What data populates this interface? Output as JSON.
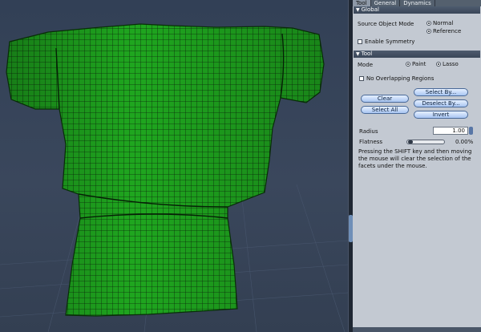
{
  "tabs": [
    {
      "label": "Tool",
      "active": true
    },
    {
      "label": "General",
      "active": false
    },
    {
      "label": "Dynamics",
      "active": false
    }
  ],
  "global": {
    "title": "Global",
    "source_label": "Source Object Mode",
    "normal": "Normal",
    "reference": "Reference",
    "symmetry": "Enable Symmetry"
  },
  "tool": {
    "title": "Tool",
    "mode_label": "Mode",
    "paint": "Paint",
    "lasso": "Lasso",
    "no_overlap": "No Overlapping Regions",
    "buttons": {
      "clear": "Clear",
      "select_all": "Select All",
      "select_by": "Select By...",
      "deselect_by": "Deselect By...",
      "invert": "Invert"
    },
    "radius_label": "Radius",
    "radius_value": "1.00",
    "flatness_label": "Flatness",
    "flatness_value": "0.00%",
    "flatness_fraction": 0.0,
    "help": "Pressing the SHIFT key and then moving the mouse will clear the selection of the facets under the mouse."
  },
  "colors": {
    "viewport_bg": "#34425a",
    "mesh_fill": "#1fa61f",
    "mesh_lines": "#0b2a0b",
    "panel_bg": "#c3c9d2",
    "button": "#a9c6f2"
  }
}
